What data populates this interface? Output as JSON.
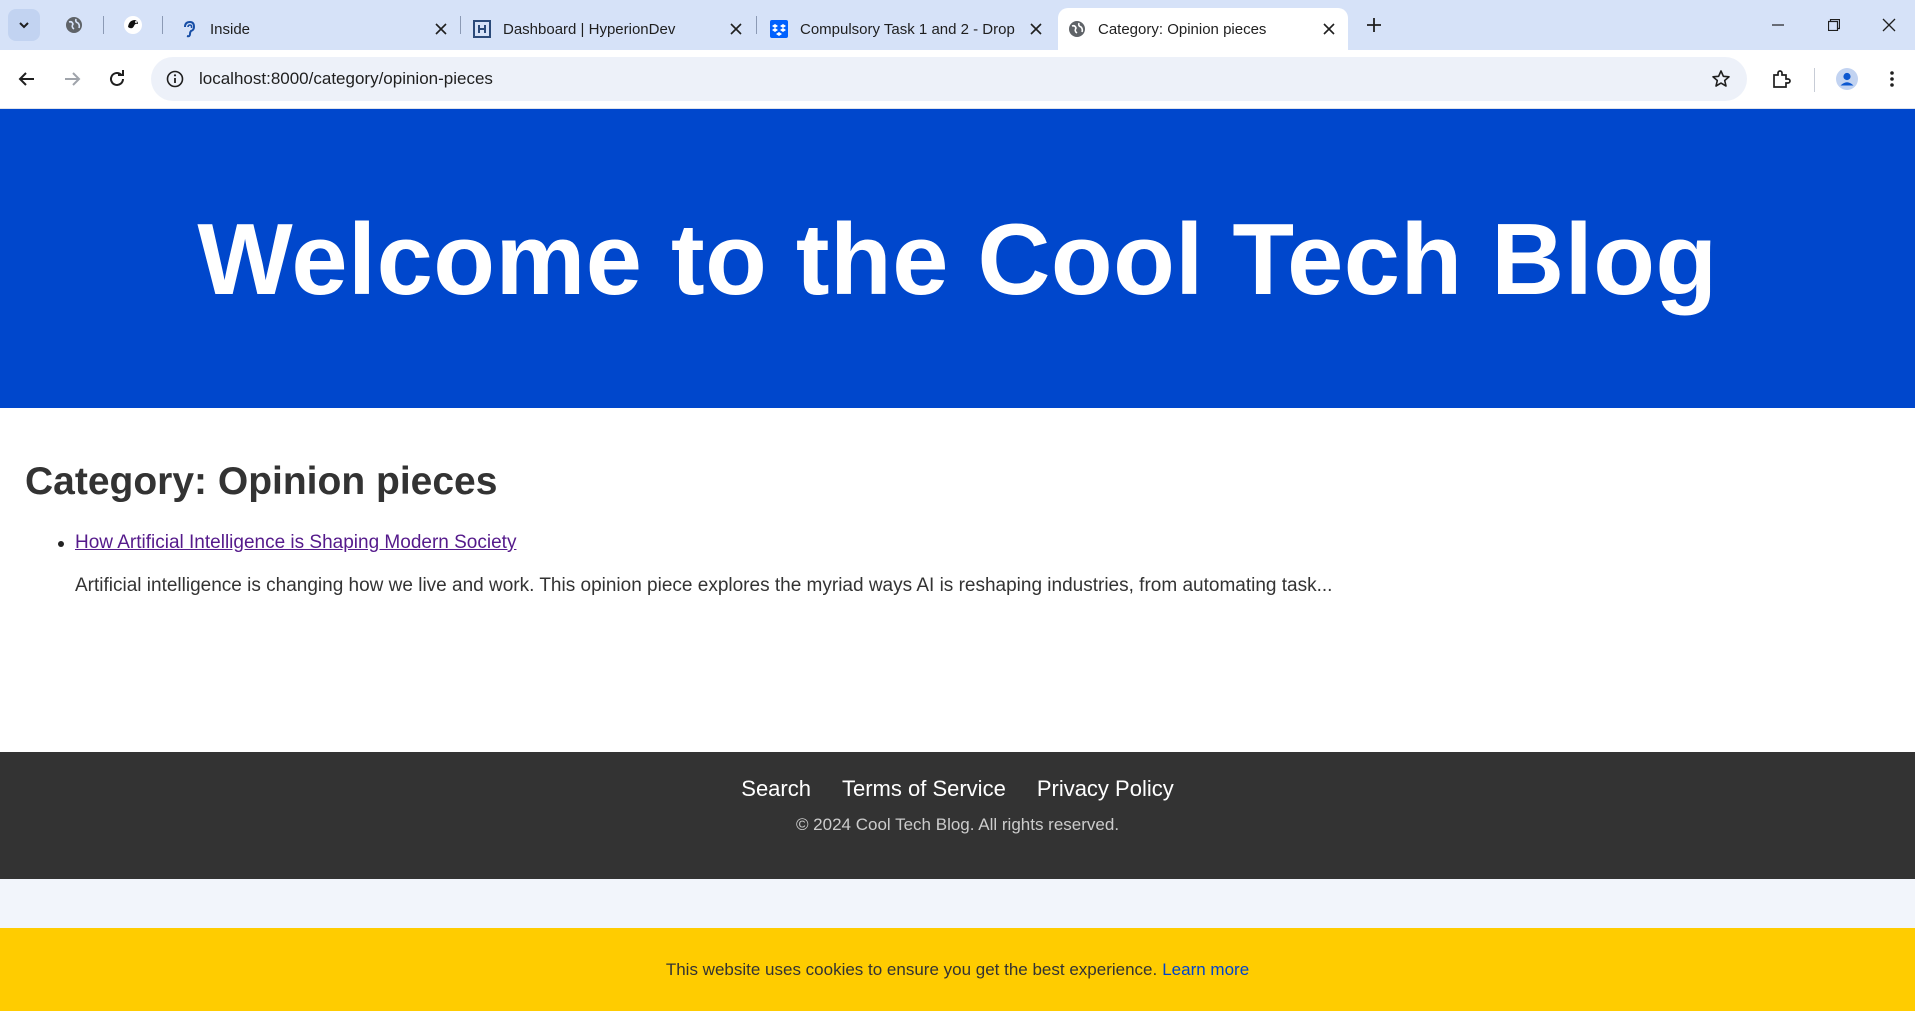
{
  "browser": {
    "tabs": [
      {
        "title": "",
        "pinned": true,
        "icon": "globe-icon"
      },
      {
        "title": "",
        "pinned": true,
        "icon": "bird-logo-icon"
      },
      {
        "title": "Inside",
        "icon": "ear-icon"
      },
      {
        "title": "Dashboard | HyperionDev",
        "icon": "hyperiondev-icon"
      },
      {
        "title": "Compulsory Task 1 and 2 - Drop",
        "icon": "dropbox-icon"
      },
      {
        "title": "Category: Opinion pieces",
        "icon": "globe-icon",
        "active": true
      }
    ],
    "url": "localhost:8000/category/opinion-pieces",
    "colors": {
      "tabstrip": "#d6e2f8",
      "toolbar": "#ffffff",
      "omnibox": "#edf1f9"
    }
  },
  "page": {
    "hero_title": "Welcome to the Cool Tech Blog",
    "category_heading": "Category: Opinion pieces",
    "posts": [
      {
        "title": "How Artificial Intelligence is Shaping Modern Society",
        "excerpt": "Artificial intelligence is changing how we live and work. This opinion piece explores the myriad ways AI is reshaping industries, from automating task..."
      }
    ],
    "footer": {
      "links": [
        "Search",
        "Terms of Service",
        "Privacy Policy"
      ],
      "copyright": "© 2024 Cool Tech Blog. All rights reserved."
    },
    "cookie_banner": {
      "text": "This website uses cookies to ensure you get the best experience.",
      "link": "Learn more"
    },
    "colors": {
      "hero": "#0047cc",
      "footer": "#333333",
      "cookie": "#ffcc00",
      "link_visited": "#551a8b"
    }
  }
}
